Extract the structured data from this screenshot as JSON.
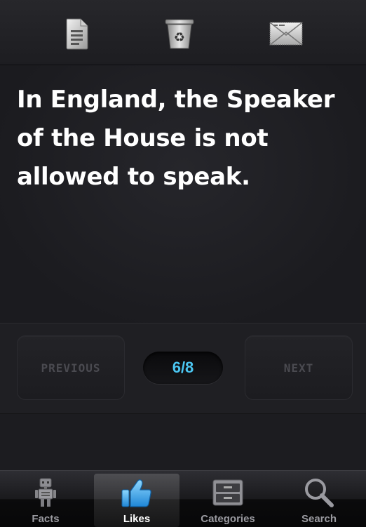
{
  "toolbar": {
    "icons": [
      "document-icon",
      "recycle-bin-icon",
      "email-icon"
    ]
  },
  "fact": {
    "text": "In England, the Speaker of the House is not allowed to speak."
  },
  "navigation": {
    "previous_label": "PREVIOUS",
    "next_label": "NEXT",
    "counter": "6/8",
    "current": 6,
    "total": 8
  },
  "tabs": [
    {
      "label": "Facts",
      "icon": "robot-icon",
      "active": false
    },
    {
      "label": "Likes",
      "icon": "thumbs-up-icon",
      "active": true
    },
    {
      "label": "Categories",
      "icon": "cabinet-icon",
      "active": false
    },
    {
      "label": "Search",
      "icon": "magnifier-icon",
      "active": false
    }
  ],
  "colors": {
    "accent": "#4bc6f2",
    "background": "#1a1a1e",
    "fact_text": "#ffffff"
  }
}
